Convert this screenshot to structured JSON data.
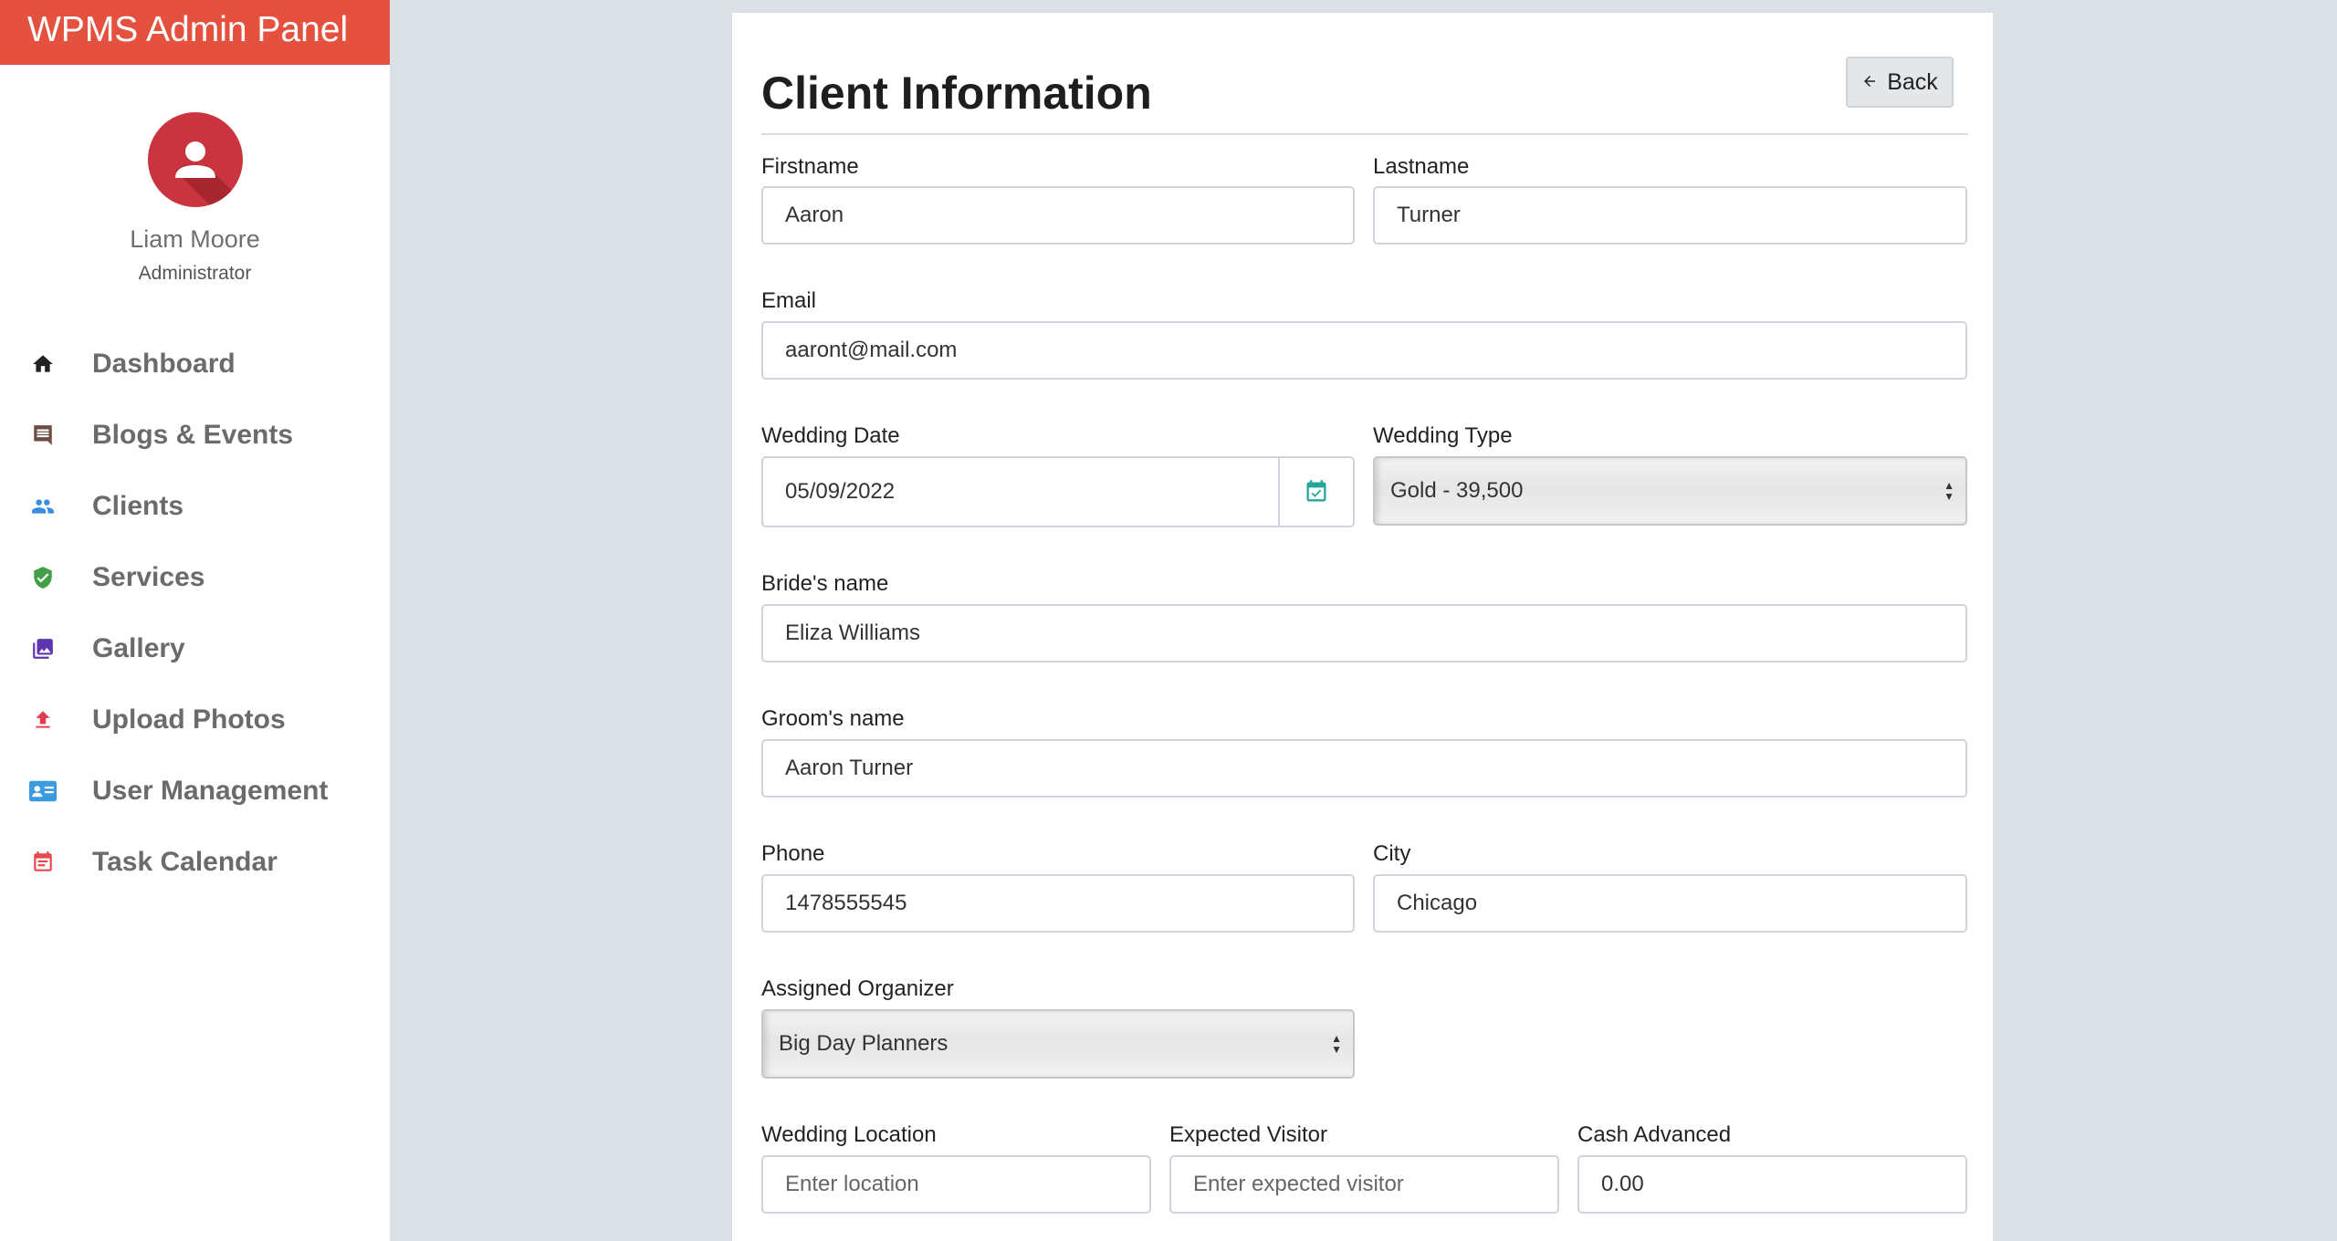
{
  "brand": {
    "title": "WPMS Admin Panel"
  },
  "profile": {
    "name": "Liam Moore",
    "role": "Administrator"
  },
  "nav": [
    {
      "label": "Dashboard",
      "icon": "home-icon",
      "color": "#222222"
    },
    {
      "label": "Blogs & Events",
      "icon": "comment-icon",
      "color": "#6d4c41"
    },
    {
      "label": "Clients",
      "icon": "people-icon",
      "color": "#3b8de0"
    },
    {
      "label": "Services",
      "icon": "shield-check-icon",
      "color": "#43a047"
    },
    {
      "label": "Gallery",
      "icon": "photo-library-icon",
      "color": "#5e35b1"
    },
    {
      "label": "Upload Photos",
      "icon": "upload-icon",
      "color": "#e53950"
    },
    {
      "label": "User Management",
      "icon": "id-card-icon",
      "color": "#3b9be0"
    },
    {
      "label": "Task Calendar",
      "icon": "calendar-icon",
      "color": "#e5484d"
    }
  ],
  "page": {
    "title": "Client Information",
    "back_label": "Back"
  },
  "form": {
    "firstname": {
      "label": "Firstname",
      "value": "Aaron"
    },
    "lastname": {
      "label": "Lastname",
      "value": "Turner"
    },
    "email": {
      "label": "Email",
      "value": "aaront@mail.com"
    },
    "wedding_date": {
      "label": "Wedding Date",
      "value": "05/09/2022"
    },
    "wedding_type": {
      "label": "Wedding Type",
      "value": "Gold - 39,500"
    },
    "bride": {
      "label": "Bride's name",
      "value": "Eliza Williams"
    },
    "groom": {
      "label": "Groom's name",
      "value": "Aaron Turner"
    },
    "phone": {
      "label": "Phone",
      "value": "1478555545"
    },
    "city": {
      "label": "City",
      "value": "Chicago"
    },
    "organizer": {
      "label": "Assigned Organizer",
      "value": "Big Day Planners"
    },
    "location": {
      "label": "Wedding Location",
      "value": "",
      "placeholder": "Enter location"
    },
    "visitor": {
      "label": "Expected Visitor",
      "value": "",
      "placeholder": "Enter expected visitor"
    },
    "cash": {
      "label": "Cash Advanced",
      "value": "0.00"
    }
  },
  "colors": {
    "brand": "#e4523f",
    "avatar": "#c9343e",
    "calendar_icon": "#26a69a"
  }
}
